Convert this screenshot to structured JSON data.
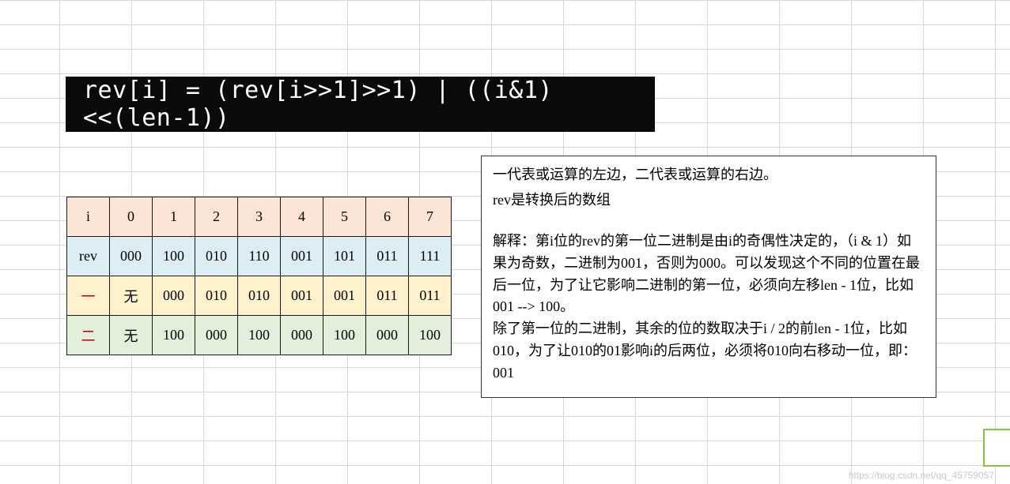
{
  "code_banner": "rev[i] = (rev[i>>1]>>1) | ((i&1)<<(len-1))",
  "table": {
    "rows": [
      {
        "key": "row-i",
        "header": "i",
        "header_class": "",
        "cells": [
          "0",
          "1",
          "2",
          "3",
          "4",
          "5",
          "6",
          "7"
        ]
      },
      {
        "key": "row-rev",
        "header": "rev",
        "header_class": "",
        "cells": [
          "000",
          "100",
          "010",
          "110",
          "001",
          "101",
          "011",
          "111"
        ]
      },
      {
        "key": "row-one",
        "header": "一",
        "header_class": "hdr-red",
        "cells": [
          "无",
          "000",
          "010",
          "010",
          "001",
          "001",
          "011",
          "011"
        ]
      },
      {
        "key": "row-two",
        "header": "二",
        "header_class": "hdr-red",
        "cells": [
          "无",
          "100",
          "000",
          "100",
          "000",
          "100",
          "000",
          "100"
        ]
      }
    ]
  },
  "explain": {
    "line1": "一代表或运算的左边，二代表或运算的右边。",
    "line2": "rev是转换后的数组",
    "para2": "解释：第i位的rev的第一位二进制是由i的奇偶性决定的，（i & 1）如果为奇数，二进制为001，否则为000。可以发现这个不同的位置在最后一位，为了让它影响二进制的第一位，必须向左移len - 1位，比如001 --> 100。",
    "para3": "除了第一位的二进制，其余的位的数取决于i / 2的前len - 1位，比如010，为了让010的01影响i的后两位，必须将010向右移动一位，即：001"
  },
  "watermark": "https://blog.csdn.net/qq_45759057"
}
